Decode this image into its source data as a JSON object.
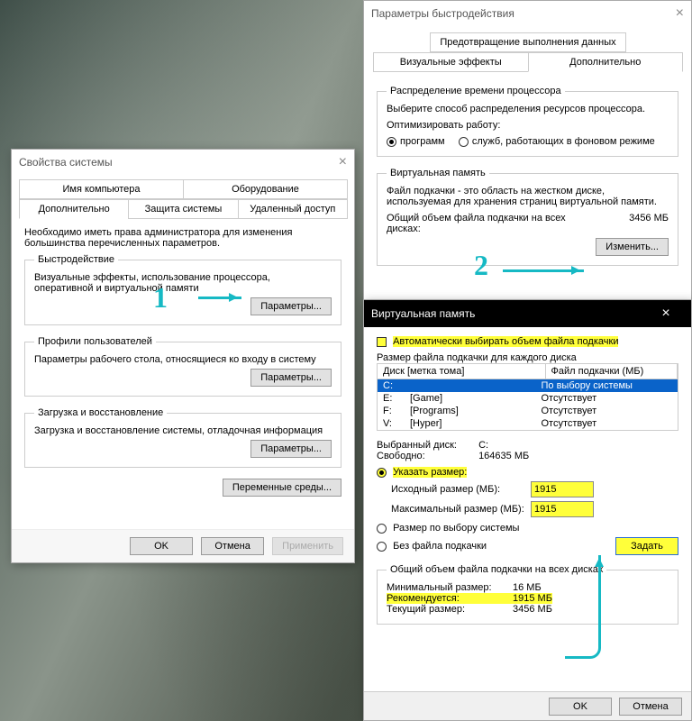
{
  "annotations": {
    "step1": "1",
    "step2": "2"
  },
  "sysprop": {
    "title": "Свойства системы",
    "tabs_top": [
      "Имя компьютера",
      "Оборудование"
    ],
    "tabs": [
      "Дополнительно",
      "Защита системы",
      "Удаленный доступ"
    ],
    "active_tab": "Дополнительно",
    "intro": "Необходимо иметь права администратора для изменения большинства перечисленных параметров.",
    "perf": {
      "legend": "Быстродействие",
      "text": "Визуальные эффекты, использование процессора, оперативной и виртуальной памяти",
      "btn": "Параметры..."
    },
    "profiles": {
      "legend": "Профили пользователей",
      "text": "Параметры рабочего стола, относящиеся ко входу в систему",
      "btn": "Параметры..."
    },
    "startup": {
      "legend": "Загрузка и восстановление",
      "text": "Загрузка и восстановление системы, отладочная информация",
      "btn": "Параметры..."
    },
    "envbtn": "Переменные среды...",
    "ok": "OK",
    "cancel": "Отмена",
    "apply": "Применить"
  },
  "perfopt": {
    "title": "Параметры быстродействия",
    "dep_tab": "Предотвращение выполнения данных",
    "tabs": [
      "Визуальные эффекты",
      "Дополнительно"
    ],
    "active_tab": "Дополнительно",
    "cpu": {
      "legend": "Распределение времени процессора",
      "text": "Выберите способ распределения ресурсов процессора.",
      "optlabel": "Оптимизировать работу:",
      "r1": "программ",
      "r2": "служб, работающих в фоновом режиме"
    },
    "vmem": {
      "legend": "Виртуальная память",
      "text": "Файл подкачки - это область на жестком диске, используемая для хранения страниц виртуальной памяти.",
      "total_label": "Общий объем файла подкачки на всех дисках:",
      "total_value": "3456 МБ",
      "btn": "Изменить..."
    }
  },
  "vmemdlg": {
    "title": "Виртуальная память",
    "auto": "Автоматически выбирать объем файла подкачки",
    "sizelabel": "Размер файла подкачки для каждого диска",
    "col1": "Диск [метка тома]",
    "col2": "Файл подкачки (МБ)",
    "rows": [
      {
        "d": "C:",
        "l": "",
        "v": "По выбору системы",
        "sel": true
      },
      {
        "d": "E:",
        "l": "[Game]",
        "v": "Отсутствует",
        "sel": false
      },
      {
        "d": "F:",
        "l": "[Programs]",
        "v": "Отсутствует",
        "sel": false
      },
      {
        "d": "V:",
        "l": "[Hyper]",
        "v": "Отсутствует",
        "sel": false
      }
    ],
    "seldrive_l": "Выбранный диск:",
    "seldrive_v": "C:",
    "free_l": "Свободно:",
    "free_v": "164635 МБ",
    "custom": "Указать размер:",
    "initial_l": "Исходный размер (МБ):",
    "initial_v": "1915",
    "max_l": "Максимальный размер (МБ):",
    "max_v": "1915",
    "sysman": "Размер по выбору системы",
    "none": "Без файла подкачки",
    "setbtn": "Задать",
    "totalgroup": "Общий объем файла подкачки на всех дисках",
    "min_l": "Минимальный размер:",
    "min_v": "16 МБ",
    "rec_l": "Рекомендуется:",
    "rec_v": "1915 МБ",
    "cur_l": "Текущий размер:",
    "cur_v": "3456 МБ",
    "ok": "OK",
    "cancel": "Отмена"
  }
}
